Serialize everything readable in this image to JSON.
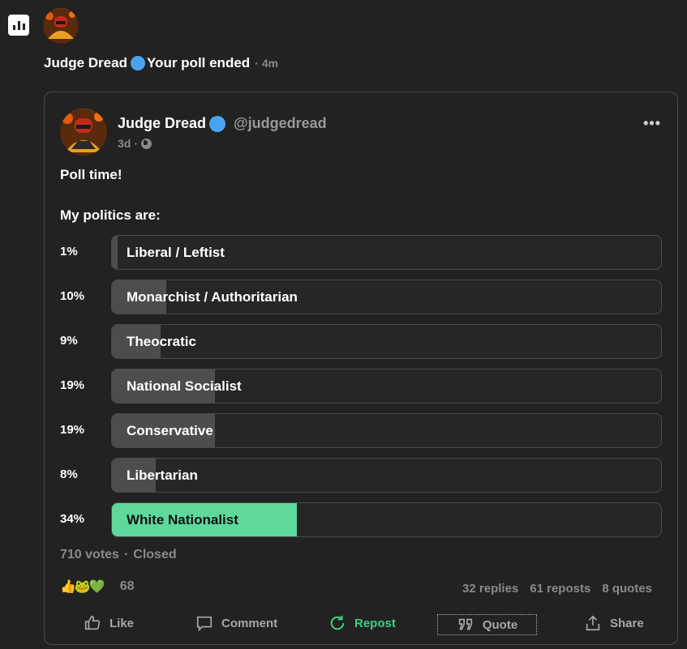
{
  "notification": {
    "icon": "poll-icon",
    "author": "Judge Dread",
    "message": "Your poll ended",
    "separator": "·",
    "time": "4m"
  },
  "post": {
    "author": "Judge Dread",
    "handle": "@judgedread",
    "age": "3d",
    "separator": "·",
    "more": "•••",
    "text_line1": "Poll time!",
    "text_line2": "My politics are:",
    "poll": [
      {
        "pct": "1%",
        "label": "Liberal / Leftist",
        "fraction": 0.01
      },
      {
        "pct": "10%",
        "label": "Monarchist / Authoritarian",
        "fraction": 0.1
      },
      {
        "pct": "9%",
        "label": "Theocratic",
        "fraction": 0.09
      },
      {
        "pct": "19%",
        "label": "National Socialist",
        "fraction": 0.19
      },
      {
        "pct": "19%",
        "label": "Conservative",
        "fraction": 0.19
      },
      {
        "pct": "8%",
        "label": "Libertarian",
        "fraction": 0.08
      },
      {
        "pct": "34%",
        "label": "White Nationalist",
        "fraction": 0.34,
        "winner": true
      }
    ],
    "votes": "710 votes",
    "votes_sep": "·",
    "status": "Closed",
    "reactions": {
      "emojis": [
        "👍",
        "🐸",
        "💚"
      ],
      "count": "68"
    },
    "replies": "32 replies",
    "reposts": "61 reposts",
    "quotes": "8 quotes"
  },
  "actions": {
    "like": "Like",
    "comment": "Comment",
    "repost": "Repost",
    "quote": "Quote",
    "share": "Share"
  },
  "colors": {
    "background": "#222222",
    "verified": "#4aa3f0",
    "winner_bar": "#5fd89c",
    "repost_active": "#3fcf85"
  }
}
